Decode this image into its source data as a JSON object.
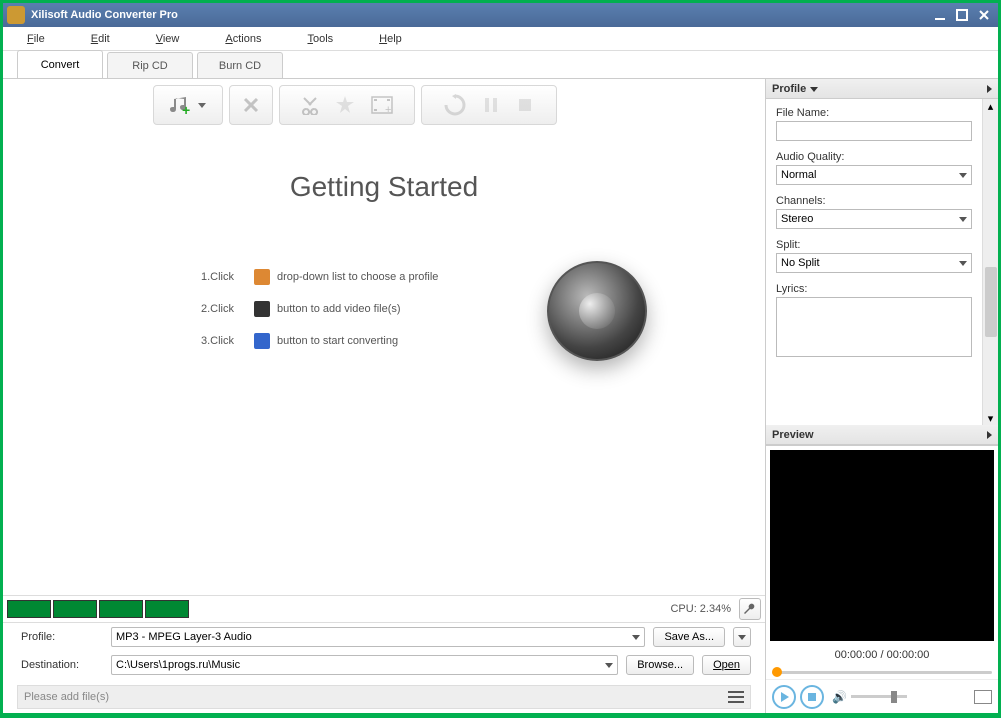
{
  "title": "Xilisoft Audio Converter Pro",
  "menu": {
    "items": [
      "File",
      "Edit",
      "View",
      "Actions",
      "Tools",
      "Help"
    ]
  },
  "tabs": [
    {
      "id": "convert",
      "label": "Convert",
      "active": true
    },
    {
      "id": "ripcd",
      "label": "Rip CD"
    },
    {
      "id": "burncd",
      "label": "Burn CD"
    }
  ],
  "gs": {
    "title": "Getting Started",
    "steps": [
      {
        "n": "1.Click",
        "text": "drop-down list to choose a profile"
      },
      {
        "n": "2.Click",
        "text": "button to add video file(s)"
      },
      {
        "n": "3.Click",
        "text": "button to start converting"
      }
    ]
  },
  "cpu": {
    "label": "CPU: 2.34%"
  },
  "profile_form": {
    "profile_label": "Profile:",
    "profile_value": "MP3 - MPEG Layer-3 Audio",
    "saveas": "Save As...",
    "dest_label": "Destination:",
    "dest_value": "C:\\Users\\1progs.ru\\Music",
    "browse": "Browse...",
    "open": "Open"
  },
  "hint": "Please add file(s)",
  "side": {
    "profile_header": "Profile",
    "filename_label": "File Name:",
    "filename_value": "",
    "audio_quality_label": "Audio Quality:",
    "audio_quality_value": "Normal",
    "channels_label": "Channels:",
    "channels_value": "Stereo",
    "split_label": "Split:",
    "split_value": "No Split",
    "lyrics_label": "Lyrics:",
    "preview_header": "Preview",
    "time": "00:00:00 / 00:00:00"
  }
}
